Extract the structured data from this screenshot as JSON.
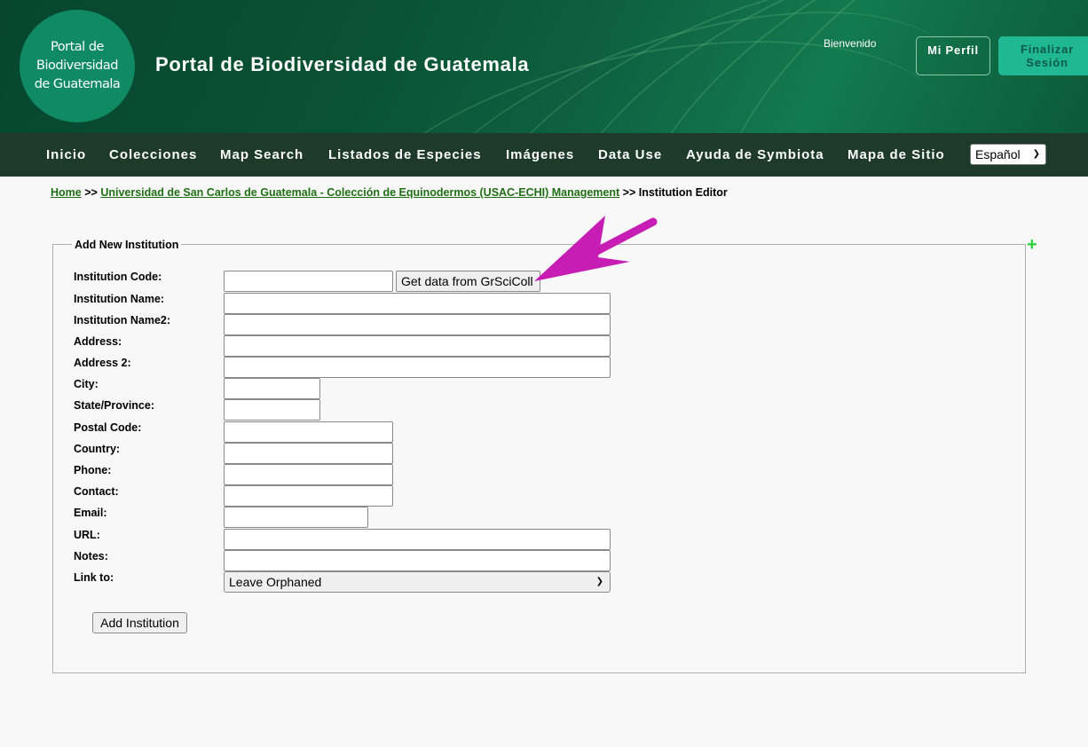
{
  "header": {
    "logo_text": "Portal de\nBiodiversidad\nde Guatemala",
    "site_title": "Portal de Biodiversidad de Guatemala",
    "welcome": "Bienvenido",
    "profile_button": "Mi Perfil",
    "logout_button": "Finalizar\nSesión"
  },
  "nav": {
    "items": [
      "Inicio",
      "Colecciones",
      "Map Search",
      "Listados de Especies",
      "Imágenes",
      "Data Use",
      "Ayuda de Symbiota",
      "Mapa de Sitio"
    ],
    "language": "Español"
  },
  "breadcrumb": {
    "home": "Home",
    "sep": ">>",
    "collection": "Universidad de San Carlos de Guatemala - Colección de Equinodermos (USAC-ECHI) Management",
    "current": "Institution Editor"
  },
  "form": {
    "legend": "Add New Institution",
    "fields": [
      {
        "label": "Institution Code:",
        "value": ""
      },
      {
        "label": "Institution Name:",
        "value": ""
      },
      {
        "label": "Institution Name2:",
        "value": ""
      },
      {
        "label": "Address:",
        "value": ""
      },
      {
        "label": "Address 2:",
        "value": ""
      },
      {
        "label": "City:",
        "value": ""
      },
      {
        "label": "State/Province:",
        "value": ""
      },
      {
        "label": "Postal Code:",
        "value": ""
      },
      {
        "label": "Country:",
        "value": ""
      },
      {
        "label": "Phone:",
        "value": ""
      },
      {
        "label": "Contact:",
        "value": ""
      },
      {
        "label": "Email:",
        "value": ""
      },
      {
        "label": "URL:",
        "value": ""
      },
      {
        "label": "Notes:",
        "value": ""
      },
      {
        "label": "Link to:",
        "value": "Leave Orphaned"
      }
    ],
    "grsci_button": "Get data from GrSciColl",
    "submit_button": "Add Institution"
  },
  "colors": {
    "header_green": "#0a5236",
    "nav_bg": "#1d3a2b",
    "link_green": "#1f6f14",
    "logout_bg": "#1fb893",
    "annotation_arrow": "#c81db4",
    "plus_icon": "#29d13a"
  }
}
